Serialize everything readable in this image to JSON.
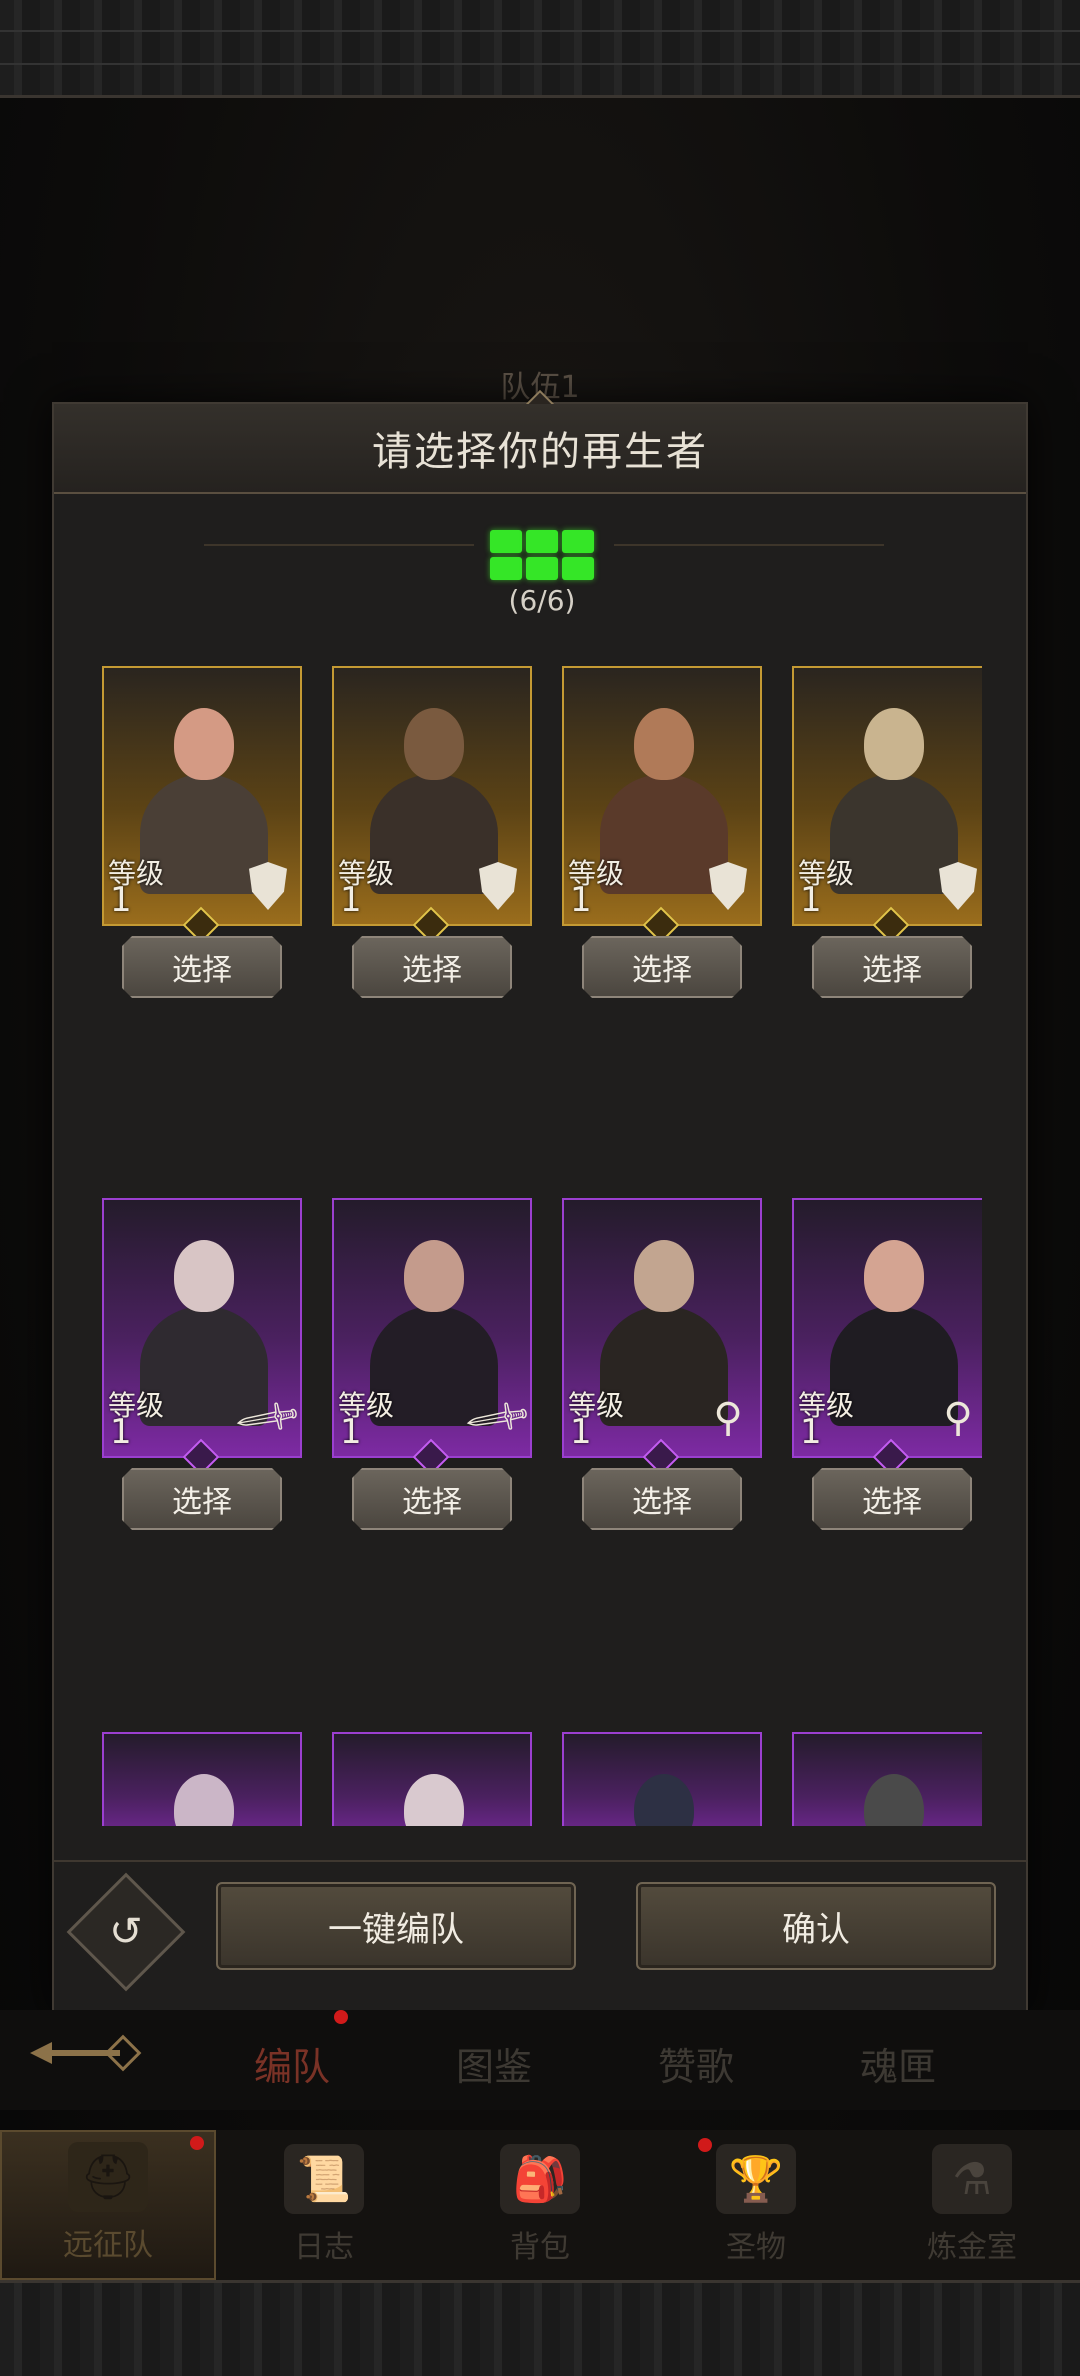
{
  "background": {
    "team_label": "队伍1"
  },
  "dialog": {
    "title": "请选择你的再生者",
    "slots_count": "(6/6)",
    "auto_team": "一键编队",
    "confirm": "确认"
  },
  "labels": {
    "level": "等级",
    "select": "选择"
  },
  "heroes": [
    {
      "rarity": "gold",
      "class": "shield",
      "level": "1"
    },
    {
      "rarity": "gold",
      "class": "shield",
      "level": "1"
    },
    {
      "rarity": "gold",
      "class": "shield",
      "level": "1"
    },
    {
      "rarity": "gold",
      "class": "shield",
      "level": "1"
    },
    {
      "rarity": "purple",
      "class": "sword",
      "level": "1"
    },
    {
      "rarity": "purple",
      "class": "sword",
      "level": "1"
    },
    {
      "rarity": "purple",
      "class": "staff",
      "level": "1"
    },
    {
      "rarity": "purple",
      "class": "staff",
      "level": "1"
    }
  ],
  "sub_tabs": [
    "编队",
    "图鉴",
    "赞歌",
    "魂匣"
  ],
  "bottom_nav": [
    "远征队",
    "日志",
    "背包",
    "圣物",
    "炼金室"
  ],
  "colors": {
    "gold_frame": "#c49a33",
    "purple_frame": "#9b3fd0",
    "slot_green": "#35e627",
    "alert_red": "#d11a1a"
  }
}
